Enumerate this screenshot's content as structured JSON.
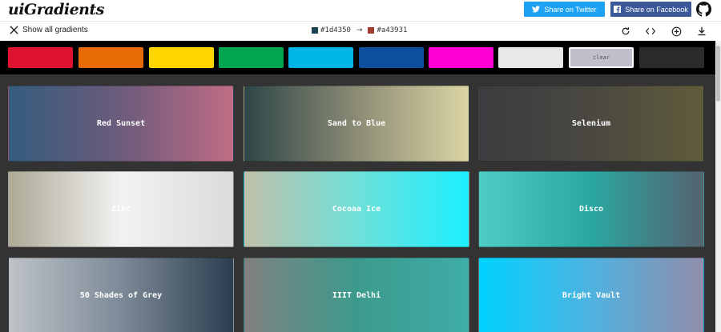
{
  "header": {
    "logo": "uiGradients",
    "share_twitter": "Share on Twitter",
    "share_facebook": "Share on Facebook"
  },
  "toolbar": {
    "show_all": "Show all gradients",
    "color_from": "#1d4350",
    "color_to": "#a43931",
    "icons": [
      "rotate-icon",
      "code-icon",
      "add-icon",
      "download-icon"
    ]
  },
  "filters": [
    {
      "name": "red",
      "color": "#e0102f"
    },
    {
      "name": "orange",
      "color": "#e86a05"
    },
    {
      "name": "yellow",
      "color": "#ffd500"
    },
    {
      "name": "green",
      "color": "#00a550"
    },
    {
      "name": "blue",
      "color": "#00b4e6"
    },
    {
      "name": "navy",
      "color": "#0b4f9e"
    },
    {
      "name": "pink",
      "color": "#ff00d4"
    },
    {
      "name": "white",
      "color": "#e8e8e8"
    },
    {
      "name": "clear",
      "color": "#c0c0cc",
      "label": "clear"
    },
    {
      "name": "black",
      "color": "#2b2b2b"
    }
  ],
  "gradients": [
    {
      "name": "Red Sunset",
      "from": "#355c7d",
      "mid": "#6c5b7b",
      "to": "#c06c84"
    },
    {
      "name": "Sand to Blue",
      "from": "#2e4647",
      "mid": "#8c8c75",
      "to": "#dbd5a4"
    },
    {
      "name": "Selenium",
      "from": "#3c3b3f",
      "mid": "#4a4840",
      "to": "#605c3c"
    },
    {
      "name": "Zinc",
      "from": "#ada996",
      "mid": "#f2f2f2",
      "to": "#dbdbdb"
    },
    {
      "name": "Cocoaa Ice",
      "from": "#c0c0aa",
      "mid": "#6fe0d8",
      "to": "#1cefff"
    },
    {
      "name": "Disco",
      "from": "#4ecdc4",
      "mid": "#2aa7a0",
      "to": "#556270"
    },
    {
      "name": "50 Shades of Grey",
      "from": "#bdc3c7",
      "mid": "#7d8a98",
      "to": "#2c3e50"
    },
    {
      "name": "IIIT Delhi",
      "from": "#808080",
      "mid": "#3c9a8c",
      "to": "#3fada8"
    },
    {
      "name": "Bright Vault",
      "from": "#00d2ff",
      "mid": "#4fb2e0",
      "to": "#928dab"
    }
  ]
}
